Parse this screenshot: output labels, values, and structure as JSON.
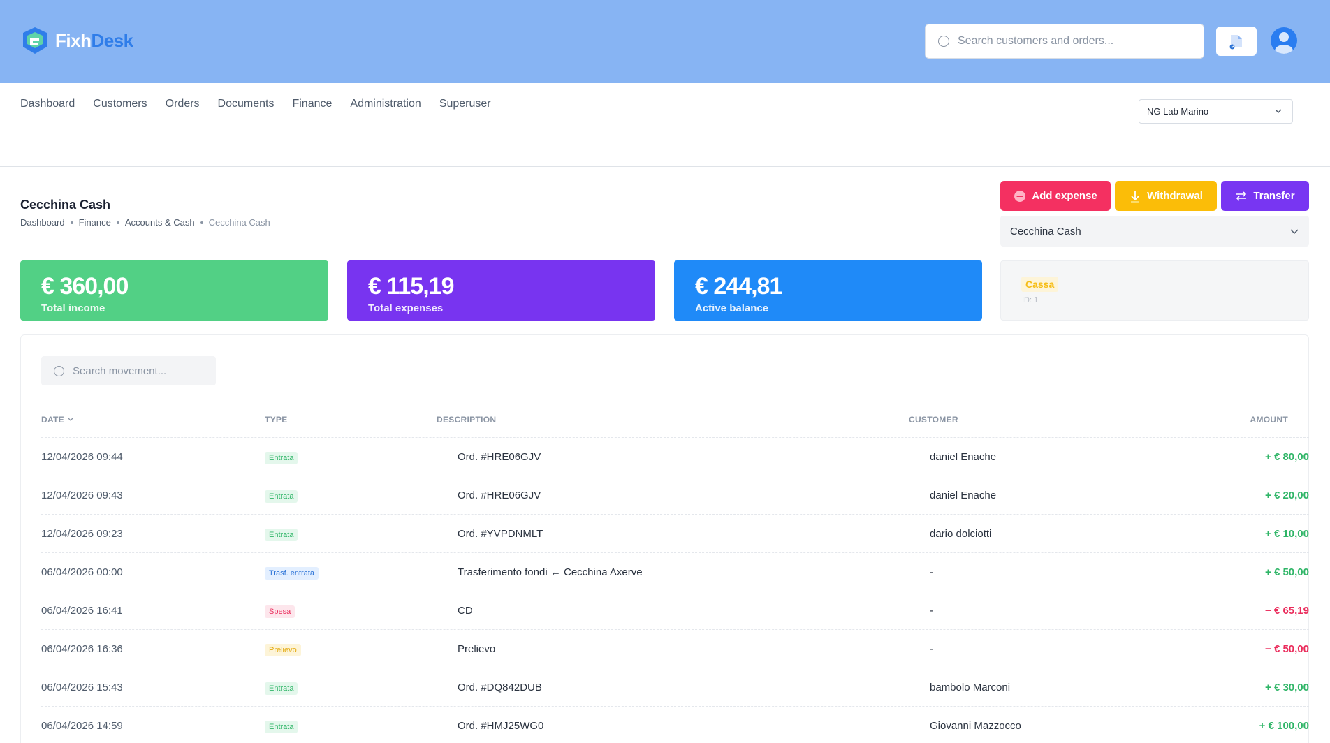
{
  "brand": {
    "name_part1": "Fixh",
    "name_part2": "Desk"
  },
  "header": {
    "search_placeholder": "Search customers and orders..."
  },
  "nav": {
    "items": [
      "Dashboard",
      "Customers",
      "Orders",
      "Documents",
      "Finance",
      "Administration",
      "Superuser"
    ],
    "lab_selected": "NG Lab Marino"
  },
  "page": {
    "title": "Cecchina Cash",
    "breadcrumb": [
      "Dashboard",
      "Finance",
      "Accounts & Cash",
      "Cecchina Cash"
    ]
  },
  "actions": {
    "add_expense": "Add expense",
    "withdrawal": "Withdrawal",
    "transfer": "Transfer",
    "account_selected": "Cecchina Cash"
  },
  "stats": {
    "income": {
      "value": "€ 360,00",
      "label": "Total income"
    },
    "expenses": {
      "value": "€ 115,19",
      "label": "Total expenses"
    },
    "balance": {
      "value": "€ 244,81",
      "label": "Active balance"
    },
    "cassa": {
      "badge": "Cassa",
      "id": "ID: 1"
    }
  },
  "movements": {
    "search_placeholder": "Search movement...",
    "columns": {
      "date": "DATE",
      "type": "TYPE",
      "description": "DESCRIPTION",
      "customer": "CUSTOMER",
      "amount": "AMOUNT"
    },
    "rows": [
      {
        "date": "12/04/2026 09:44",
        "type": "Entrata",
        "kind": "in",
        "description": "Ord. #HRE06GJV",
        "customer": "daniel Enache",
        "amount": "+ € 80,00",
        "sign": "pos"
      },
      {
        "date": "12/04/2026 09:43",
        "type": "Entrata",
        "kind": "in",
        "description": "Ord. #HRE06GJV",
        "customer": "daniel Enache",
        "amount": "+ € 20,00",
        "sign": "pos"
      },
      {
        "date": "12/04/2026 09:23",
        "type": "Entrata",
        "kind": "in",
        "description": "Ord. #YVPDNMLT",
        "customer": "dario dolciotti",
        "amount": "+ € 10,00",
        "sign": "pos"
      },
      {
        "date": "06/04/2026 00:00",
        "type": "Trasf. entrata",
        "kind": "tr",
        "description": "Trasferimento fondi ← Cecchina Axerve",
        "customer": "-",
        "amount": "+ € 50,00",
        "sign": "pos"
      },
      {
        "date": "06/04/2026 16:41",
        "type": "Spesa",
        "kind": "sp",
        "description": "CD",
        "customer": "-",
        "amount": "− € 65,19",
        "sign": "neg"
      },
      {
        "date": "06/04/2026 16:36",
        "type": "Prelievo",
        "kind": "pr",
        "description": "Prelievo",
        "customer": "-",
        "amount": "− € 50,00",
        "sign": "neg"
      },
      {
        "date": "06/04/2026 15:43",
        "type": "Entrata",
        "kind": "in",
        "description": "Ord. #DQ842DUB",
        "customer": "bambolo Marconi",
        "amount": "+ € 30,00",
        "sign": "pos"
      },
      {
        "date": "06/04/2026 14:59",
        "type": "Entrata",
        "kind": "in",
        "description": "Ord. #HMJ25WG0",
        "customer": "Giovanni Mazzocco",
        "amount": "+ € 100,00",
        "sign": "pos"
      }
    ]
  }
}
